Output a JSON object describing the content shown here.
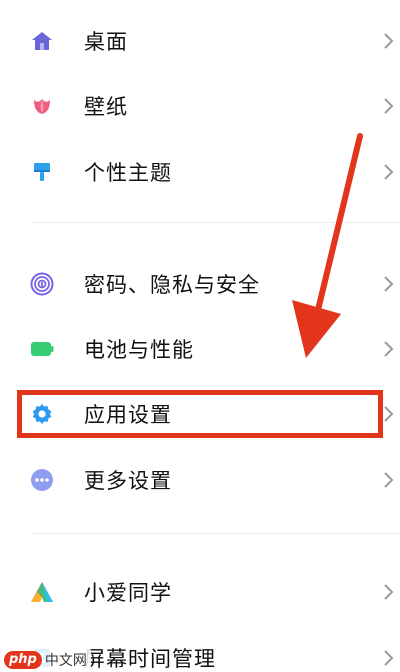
{
  "settings": {
    "items": [
      {
        "label": "桌面",
        "icon": "home-icon",
        "color": "#6b66d8"
      },
      {
        "label": "壁纸",
        "icon": "flower-icon",
        "color": "#ee5c7e"
      },
      {
        "label": "个性主题",
        "icon": "brush-icon",
        "color": "#2fa0ee"
      },
      {
        "label": "密码、隐私与安全",
        "icon": "fingerprint-icon",
        "color": "#7b63e6"
      },
      {
        "label": "电池与性能",
        "icon": "battery-icon",
        "color": "#36cc72"
      },
      {
        "label": "应用设置",
        "icon": "gear-icon",
        "color": "#2d9bf0"
      },
      {
        "label": "更多设置",
        "icon": "more-dots-icon",
        "color": "#8e9df0"
      },
      {
        "label": "小爱同学",
        "icon": "xiaoai-icon",
        "color": "#e84fa0"
      },
      {
        "label": "屏幕时间管理",
        "icon": "hourglass-icon",
        "color": "#2d9bf0"
      }
    ]
  },
  "annotation": {
    "highlight_color": "#e3341c",
    "highlighted_item": "应用设置"
  },
  "watermark": {
    "logo": "php",
    "text": "中文网"
  }
}
